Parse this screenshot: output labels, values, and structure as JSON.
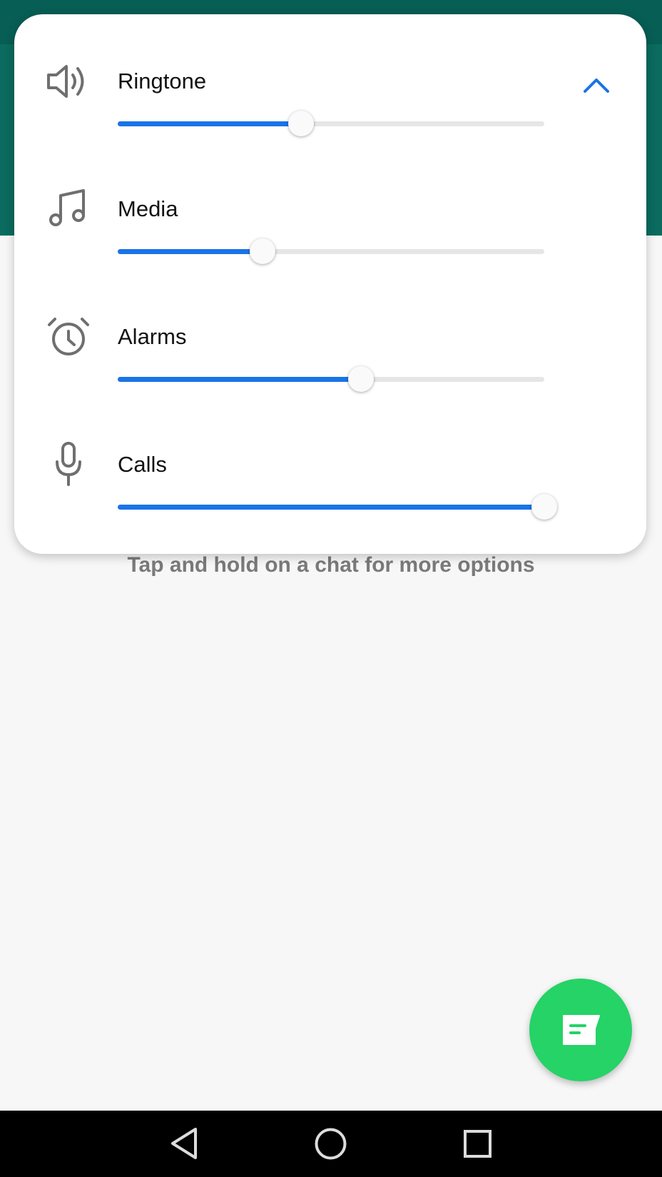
{
  "background": {
    "hint": "Tap and hold on a chat for more options"
  },
  "volume_panel": {
    "accent_color": "#1a73e8",
    "rows": [
      {
        "label": "Ringtone",
        "icon": "speaker-icon",
        "level": 0.43
      },
      {
        "label": "Media",
        "icon": "music-note-icon",
        "level": 0.34
      },
      {
        "label": "Alarms",
        "icon": "alarm-clock-icon",
        "level": 0.57
      },
      {
        "label": "Calls",
        "icon": "microphone-icon",
        "level": 1.0
      }
    ],
    "collapse_icon": "chevron-up-icon"
  },
  "fab": {
    "icon": "new-chat-icon",
    "color": "#25d366"
  },
  "nav_bar": {
    "buttons": [
      "back-icon",
      "home-icon",
      "recents-icon"
    ]
  }
}
